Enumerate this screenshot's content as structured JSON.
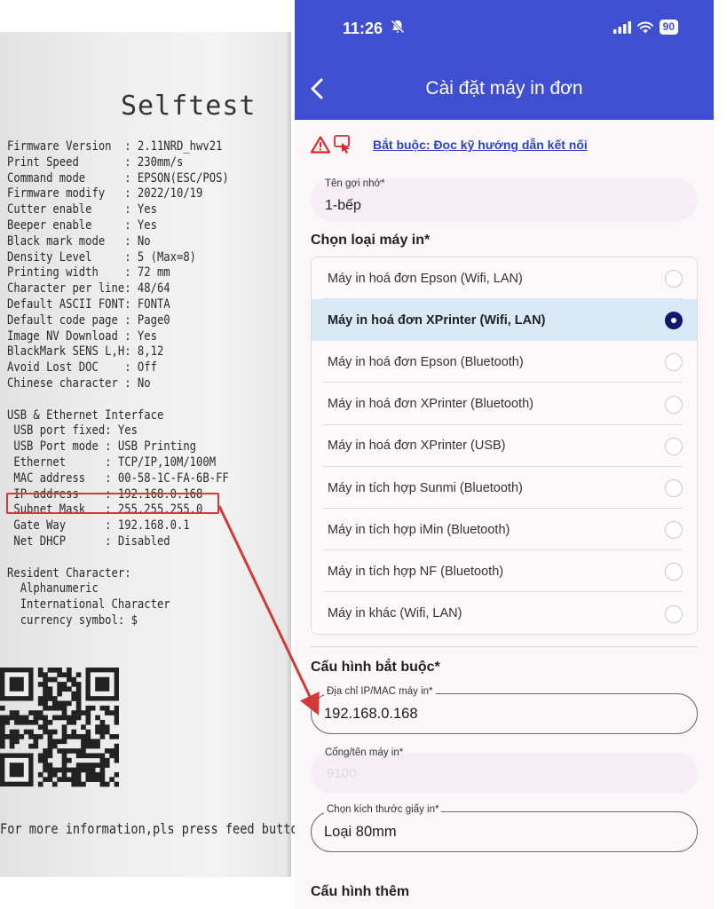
{
  "receipt": {
    "title": "Selftest",
    "lines": [
      "Firmware Version  : 2.11NRD_hwv21",
      "Print Speed       : 230mm/s",
      "Command mode      : EPSON(ESC/POS)",
      "Firmware modify   : 2022/10/19",
      "Cutter enable     : Yes",
      "Beeper enable     : Yes",
      "Black mark mode   : No",
      "Density Level     : 5 (Max=8)",
      "Printing width    : 72 mm",
      "Character per line: 48/64",
      "Default ASCII FONT: FONTA",
      "Default code page : Page0",
      "Image NV Download : Yes",
      "BlackMark SENS L,H: 8,12",
      "Avoid Lost DOC    : Off",
      "Chinese character : No",
      "",
      "USB & Ethernet Interface",
      " USB port fixed: Yes",
      " USB Port mode : USB Printing",
      " Ethernet      : TCP/IP,10M/100M",
      " MAC address   : 00-58-1C-FA-6B-FF",
      " IP address    : 192.168.0.168",
      " Subnet Mask   : 255.255.255.0",
      " Gate Way      : 192.168.0.1",
      " Net DHCP      : Disabled",
      "",
      "Resident Character:",
      "  Alphanumeric",
      "  International Character",
      "  currency symbol: $"
    ],
    "footer": "For more information,pls press feed button"
  },
  "status_bar": {
    "time": "11:26",
    "battery": "90"
  },
  "header": {
    "title": "Cài đặt máy in đơn"
  },
  "warning": {
    "link_text": "Bắt buộc: Đọc kỹ hướng dẫn kết nối"
  },
  "nickname": {
    "label": "Tên gợi nhớ*",
    "value": "1-bếp"
  },
  "printer_type": {
    "section_title": "Chọn loại máy in*",
    "options": [
      {
        "label": "Máy in hoá đơn Epson (Wifi, LAN)",
        "selected": false
      },
      {
        "label": "Máy in hoá đơn XPrinter (Wifi, LAN)",
        "selected": true
      },
      {
        "label": "Máy in hoá đơn Epson (Bluetooth)",
        "selected": false
      },
      {
        "label": "Máy in hoá đơn XPrinter (Bluetooth)",
        "selected": false
      },
      {
        "label": "Máy in hoá đơn XPrinter (USB)",
        "selected": false
      },
      {
        "label": "Máy in tích hợp Sunmi (Bluetooth)",
        "selected": false
      },
      {
        "label": "Máy in tích hợp iMin (Bluetooth)",
        "selected": false
      },
      {
        "label": "Máy in tích hợp NF (Bluetooth)",
        "selected": false
      },
      {
        "label": "Máy in khác (Wifi, LAN)",
        "selected": false
      }
    ]
  },
  "required_config": {
    "section_title": "Cấu hình bắt buộc*",
    "ip_label": "Địa chỉ IP/MAC máy in*",
    "ip_value": "192.168.0.168",
    "port_label": "Cổng/tên máy in*",
    "port_placeholder": "9100",
    "paper_label": "Chọn kích thước giấy in*",
    "paper_value": "Loại 80mm"
  },
  "extra_config": {
    "section_title": "Cấu hình thêm"
  },
  "colors": {
    "header_blue": "#3f4fd0",
    "link_blue": "#2b43c9",
    "selected_row": "#d9e9f7",
    "radio_on": "#13196b",
    "annotation_red": "#d23a3a"
  }
}
